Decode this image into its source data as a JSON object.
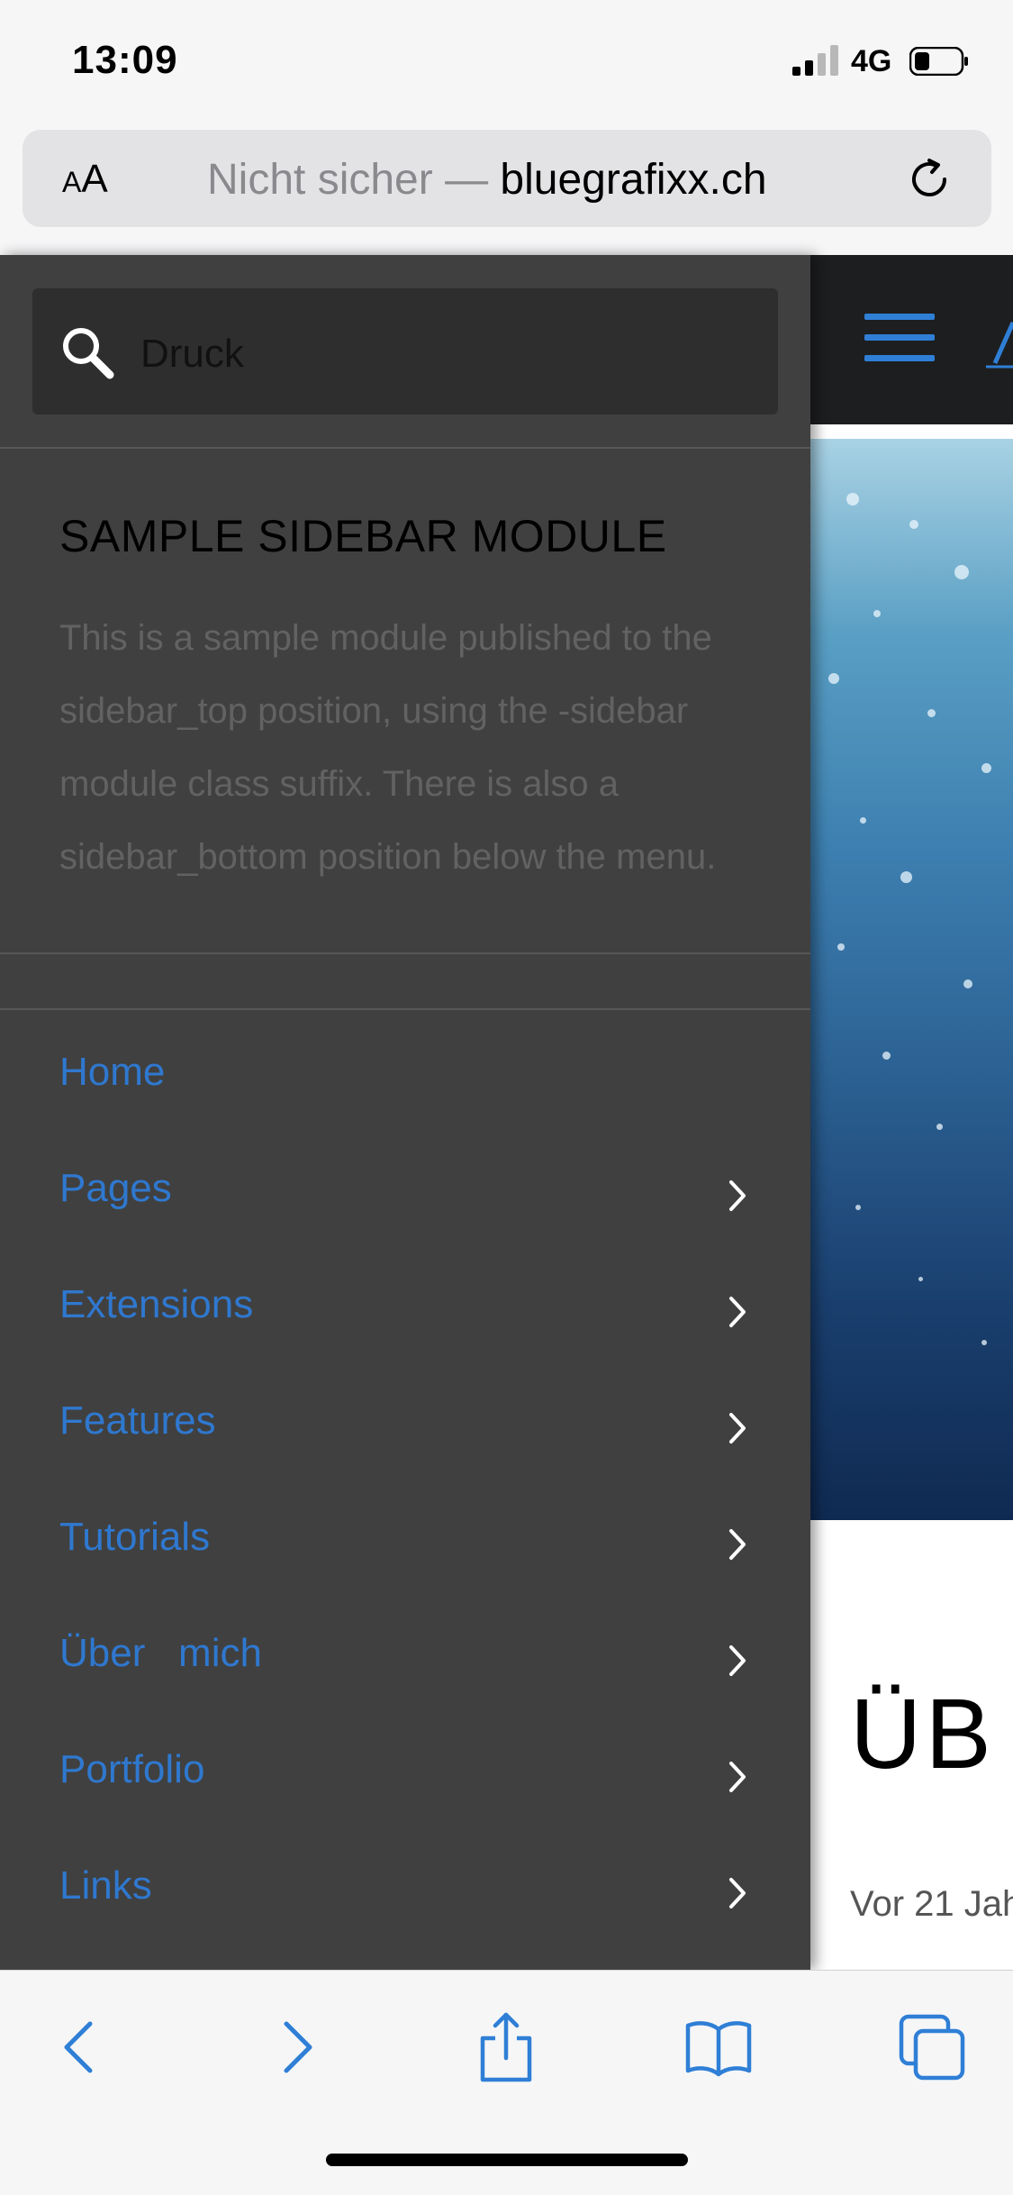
{
  "status_bar": {
    "time": "13:09",
    "network": "4G",
    "signal_icon": "cellular-signal-icon",
    "battery_icon": "battery-icon"
  },
  "browser": {
    "text_size_label_small": "A",
    "text_size_label_large": "A",
    "url_prefix": "Nicht sicher — ",
    "url_domain": "bluegrafixx.ch",
    "reload_icon": "reload-icon"
  },
  "sidebar": {
    "search": {
      "value": "Druck",
      "icon": "search-icon"
    },
    "module": {
      "title": "SAMPLE SIDEBAR MODULE",
      "text": "This is a sample module published to the sidebar_top position, using the -sidebar module class suffix. There is also a sidebar_bottom position below the menu."
    },
    "menu": [
      {
        "label": "Home",
        "has_children": false
      },
      {
        "label": "Pages",
        "has_children": true
      },
      {
        "label": "Extensions",
        "has_children": true
      },
      {
        "label": "Features",
        "has_children": true
      },
      {
        "label": "Tutorials",
        "has_children": true
      },
      {
        "label": "Über   mich",
        "has_children": true
      },
      {
        "label": "Portfolio",
        "has_children": true
      },
      {
        "label": "Links",
        "has_children": true
      }
    ]
  },
  "page": {
    "heading_partial": "ÜB",
    "teaser_partial": "Vor 21 Jah",
    "accent_color": "#2f7fd6"
  },
  "toolbar": {
    "back_icon": "back-icon",
    "forward_icon": "forward-icon",
    "share_icon": "share-icon",
    "bookmarks_icon": "bookmarks-icon",
    "tabs_icon": "tabs-icon"
  }
}
